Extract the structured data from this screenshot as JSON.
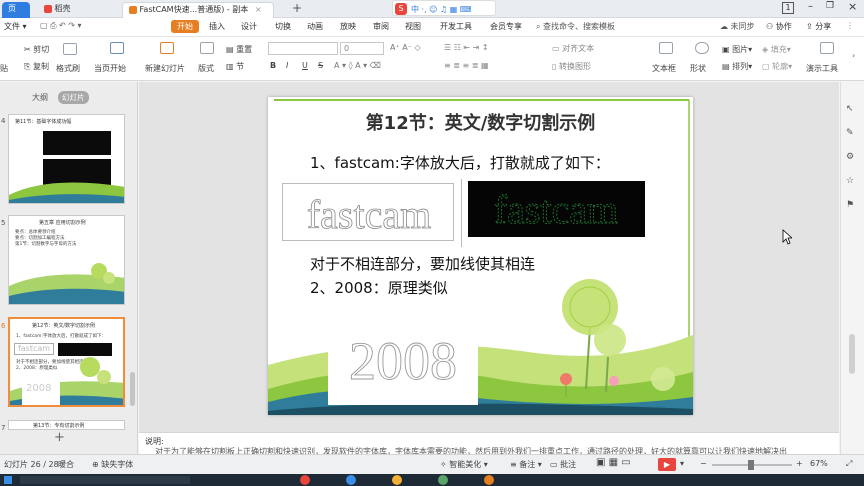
{
  "tabs": [
    {
      "label": "页"
    },
    {
      "label": "稻壳"
    },
    {
      "label": "FastCAM快速...普通版) - 副本"
    }
  ],
  "topright": {
    "badge": "1"
  },
  "menus": [
    "文件",
    "开始",
    "插入",
    "设计",
    "切换",
    "动画",
    "放映",
    "审阅",
    "视图",
    "开发工具",
    "会员专享"
  ],
  "search_placeholder": "查找命令、搜索模板",
  "menu_right": [
    "未同步",
    "协作",
    "分享"
  ],
  "toolbar": {
    "paste": "贴",
    "cut": "剪切",
    "copy": "复制",
    "format_painter": "格式刷",
    "from_current": "当页开始",
    "new_slide": "新建幻灯片",
    "layout": "版式",
    "section": "节",
    "reset": "重置",
    "font_size": "0",
    "bold": "B",
    "italic": "I",
    "underline": "U",
    "strike": "S",
    "text_box": "文本框",
    "shape": "形状",
    "arrange": "排列",
    "picture": "图片",
    "fill": "填充",
    "outline": "轮廓",
    "play": "演示工具",
    "align_text": "对齐文本",
    "smart_art": "转换图形"
  },
  "left_panel": {
    "view_outline": "大纲",
    "view_slides": "幻灯片",
    "thumbnails": [
      {
        "num": "4",
        "title": "第11节：基础字体成功幅",
        "lines": []
      },
      {
        "num": "5",
        "title": "第五章 应用切割示例",
        "lines": [
          "要点：总体要领介绍",
          "要点：切割加工编程方法",
          "第1节：切割数字与字母的方法"
        ]
      },
      {
        "num": "6",
        "title": "第12节：英文/数字切割示例",
        "lines": [
          "1、fastcam:字体放大后，打散就成了如下：",
          "对于不相连部分，要加线使其相连",
          "2、2008：原理类似"
        ]
      },
      {
        "num": "7",
        "title": "第13节：专有切割示例",
        "lines": []
      }
    ],
    "add_label": "+"
  },
  "slide": {
    "title": "第12节：英文/数字切割示例",
    "line1": "1、fastcam:字体放大后，打散就成了如下：",
    "outline_word": "fastcam",
    "line2": "对于不相连部分，要加线使其相连",
    "line3": "2、2008：原理类似",
    "outline_number": "2008"
  },
  "notes": {
    "label": "说明:",
    "text": "对于为了能够在切割板上正确切割和快速识别，发现软件的字体库，字体库本需要的功能，然后用到外我们一排重点工作，通过路径的处理，好大的就算靠可以让我们快速地解决出"
  },
  "status": {
    "slide_count": "幻灯片 26 / 28",
    "theme": "暖合",
    "missing_font": "缺失字体",
    "smart_beautify": "智能美化",
    "notes_btn": "备注",
    "comments_btn": "批注",
    "zoom": "67%"
  },
  "colors": {
    "accent_orange": "#e67e22",
    "selected_border": "#f08c3a",
    "slide_green": "#8dc63f",
    "play_red": "#e8453c"
  }
}
